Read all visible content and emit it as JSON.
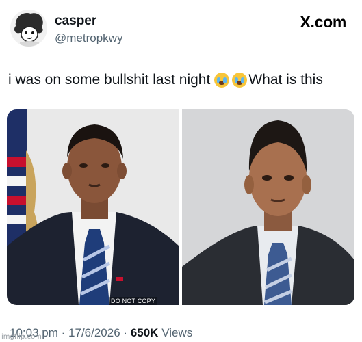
{
  "author": {
    "display_name": "casper",
    "handle": "@metropkwy",
    "avatar_icon": "sheep-avatar-icon"
  },
  "brand": {
    "label": "X.com"
  },
  "tweet": {
    "text_part1": "i was on some bullshit last night",
    "text_part2": "What is this",
    "emojis": [
      "loudly-crying-face-icon",
      "loudly-crying-face-icon"
    ]
  },
  "media": {
    "left": {
      "watermark": "DO NOT COPY"
    },
    "right": {}
  },
  "meta": {
    "time": "10:03 pm",
    "separator": "·",
    "date": "17/6/2026",
    "views_count": "650K",
    "views_label": "Views"
  },
  "site_watermark": "imgflip.com",
  "colors": {
    "text_primary": "#0f1419",
    "text_secondary": "#536471",
    "emoji_face": "#f7c53a",
    "emoji_tears": "#5db6ef"
  }
}
